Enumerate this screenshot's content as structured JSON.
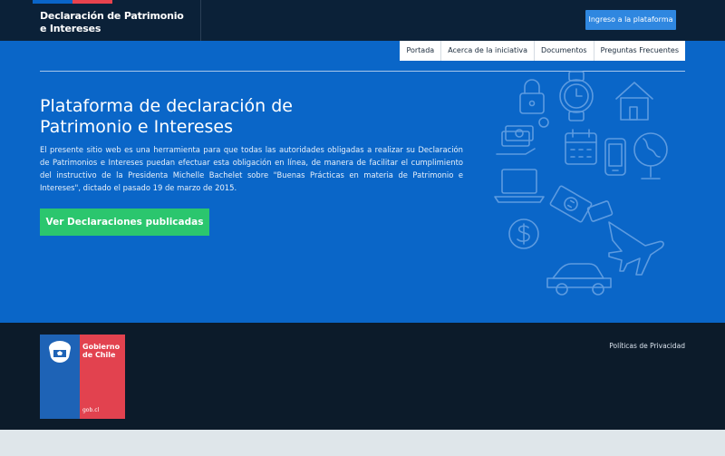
{
  "header": {
    "title_line1": "Declaración de Patrimonio",
    "title_line2": "e Intereses",
    "login_button": "Ingreso a la plataforma"
  },
  "nav": {
    "tabs": [
      "Portada",
      "Acerca de la iniciativa",
      "Documentos",
      "Preguntas Frecuentes"
    ]
  },
  "hero": {
    "title_line1": "Plataforma de declaración de",
    "title_line2": "Patrimonio e Intereses",
    "description": "El presente sitio web es una herramienta para que todas las autoridades obligadas a realizar su Declaración de Patrimonios e Intereses puedan efectuar esta obligación en línea, de manera de facilitar el cumplimiento del instructivo de la Presidenta Michelle Bachelet sobre \"Buenas Prácticas en materia de Patrimonio e Intereses\", dictado el pasado 19 de marzo de 2015.",
    "cta_button": "Ver Declaraciones publicadas"
  },
  "footer": {
    "logo_line1": "Gobierno",
    "logo_line2": "de Chile",
    "logo_url": "gob.cl",
    "privacy_link": "Políticas de Privacidad"
  },
  "colors": {
    "header_bg": "#0b2138",
    "hero_bg": "#0a66c8",
    "cta_green": "#2bc66e",
    "login_btn": "#2f87e0",
    "footer_bg": "#0c1b2a"
  },
  "icons": [
    "padlock-icon",
    "watch-icon",
    "house-icon",
    "money-stack-icon",
    "dollar-coin-icon",
    "calendar-icon",
    "phone-icon",
    "globe-icon",
    "laptop-icon",
    "banknote-icon",
    "airplane-icon",
    "car-icon"
  ]
}
